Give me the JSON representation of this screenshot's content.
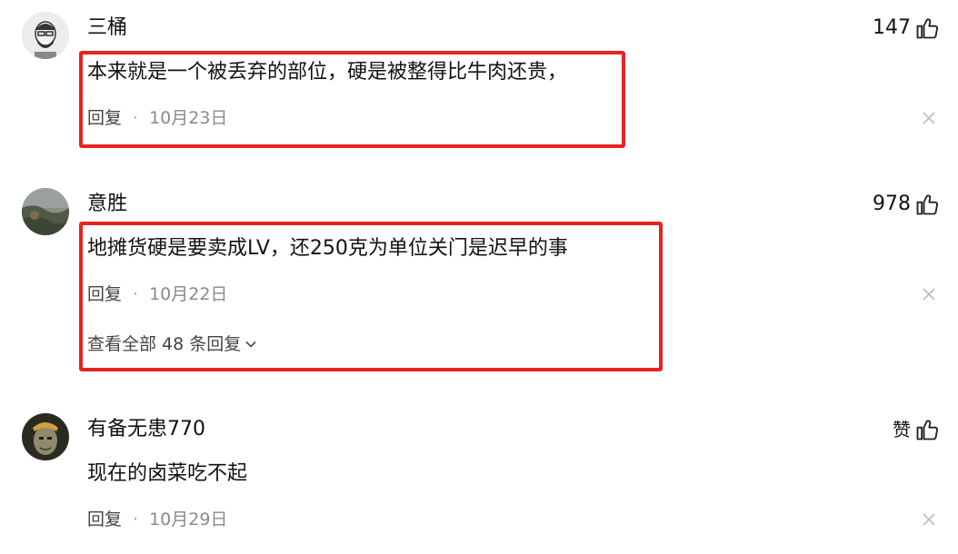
{
  "comments": [
    {
      "author": "三桶",
      "likes": "147",
      "text": "本来就是一个被丢弃的部位，硬是被整得比牛肉还贵，",
      "reply_label": "回复",
      "separator": "·",
      "date": "10月23日"
    },
    {
      "author": "意胜",
      "likes": "978",
      "text": "地摊货硬是要卖成LV，还250克为单位关门是迟早的事",
      "reply_label": "回复",
      "separator": "·",
      "date": "10月22日",
      "view_all": "查看全部 48 条回复"
    },
    {
      "author": "有备无患770",
      "likes": "赞",
      "text": "现在的卤菜吃不起",
      "reply_label": "回复",
      "separator": "·",
      "date": "10月29日"
    }
  ],
  "icons": {
    "like": "thumbs-up-icon",
    "close": "close-icon",
    "chevron": "chevron-down-icon"
  },
  "colors": {
    "highlight_border": "#e8231f",
    "meta_text": "#8a8a8a"
  }
}
